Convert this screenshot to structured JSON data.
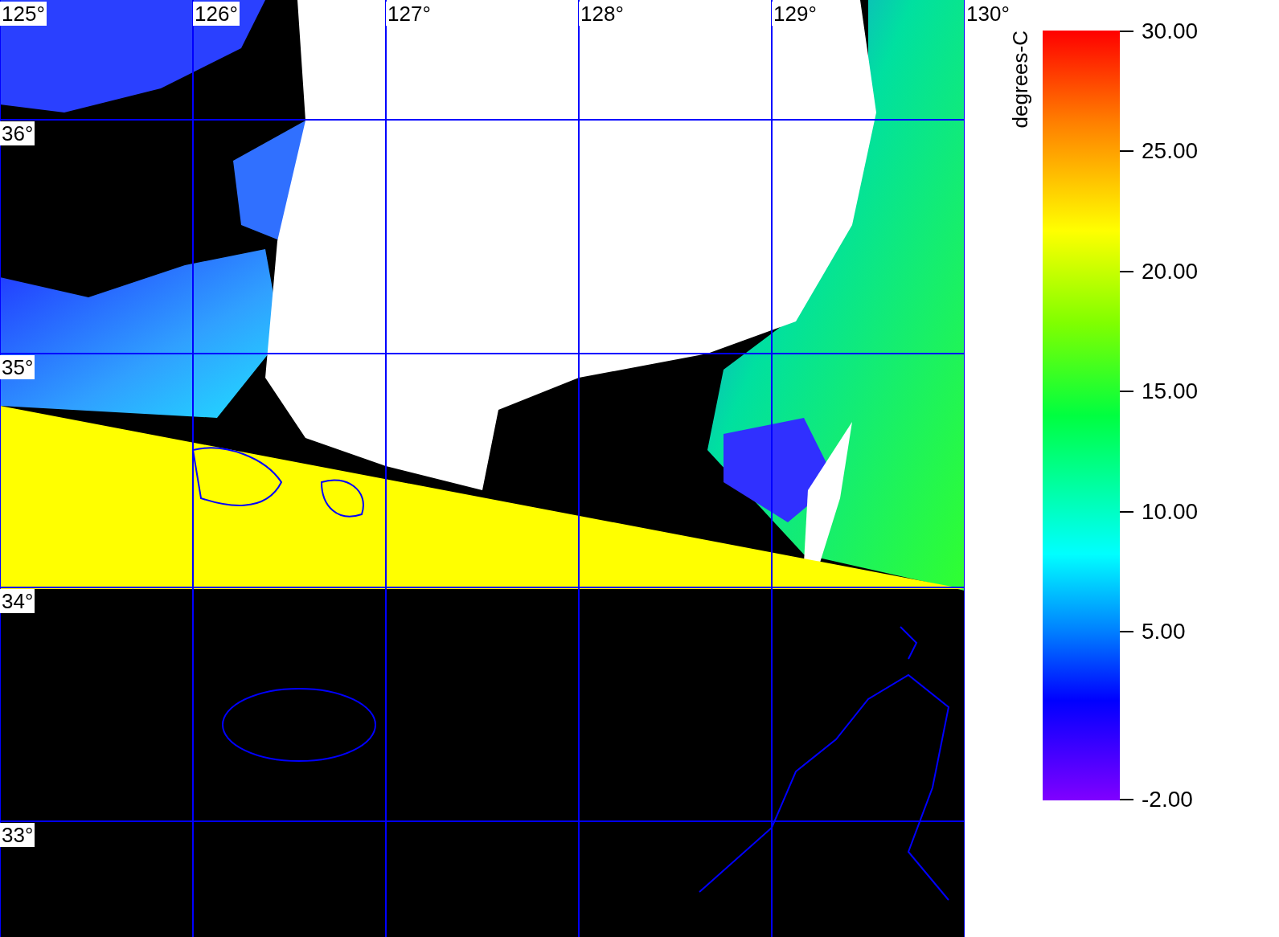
{
  "map": {
    "longitude_labels": [
      "125°",
      "126°",
      "127°",
      "128°",
      "129°",
      "130°"
    ],
    "latitude_labels": [
      "36°",
      "35°",
      "34°",
      "33°"
    ]
  },
  "colorbar": {
    "title": "degrees-C",
    "ticks": [
      "30.00",
      "25.00",
      "20.00",
      "15.00",
      "10.00",
      "5.00",
      "-2.00"
    ]
  }
}
